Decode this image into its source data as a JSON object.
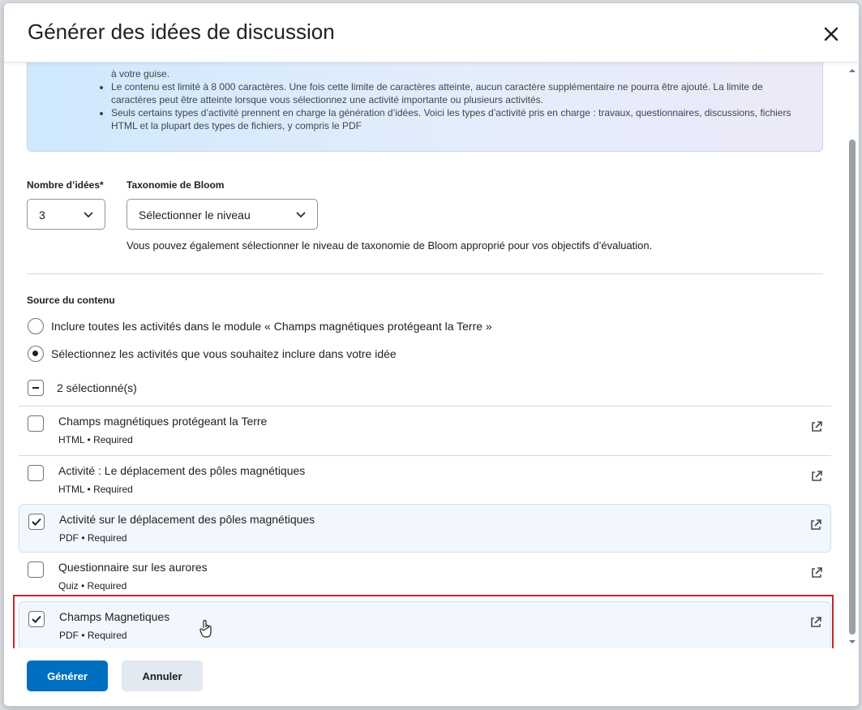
{
  "dialog": {
    "title": "Générer des idées de discussion"
  },
  "info": {
    "line0": "à votre guise.",
    "bullets": [
      "Le contenu est limité à 8 000 caractères. Une fois cette limite de caractères atteinte, aucun caractère supplémentaire ne pourra être ajouté. La limite de caractères peut être atteinte lorsque vous sélectionnez une activité importante ou plusieurs activités.",
      "Seuls certains types d’activité prennent en charge la génération d’idées. Voici les types d’activité pris en charge : travaux, questionnaires, discussions, fichiers HTML et la plupart des types de fichiers, y compris le PDF"
    ]
  },
  "form": {
    "ideas_label": "Nombre d’idées*",
    "ideas_value": "3",
    "bloom_label": "Taxonomie de Bloom",
    "bloom_value": "Sélectionner le niveau",
    "bloom_hint": "Vous pouvez également sélectionner le niveau de taxonomie de Bloom approprié pour vos objectifs d’évaluation."
  },
  "source": {
    "label": "Source du contenu",
    "options": [
      {
        "label": "Inclure toutes les activités dans le module « Champs magnétiques protégeant la Terre »",
        "selected": false
      },
      {
        "label": "Sélectionnez les activités que vous souhaitez inclure dans votre idée",
        "selected": true
      }
    ],
    "selected_count": "2 sélectionné(s)"
  },
  "activities": [
    {
      "name": "Champs magnétiques protégeant la Terre",
      "meta": "HTML • Required",
      "checked": false
    },
    {
      "name": "Activité : Le déplacement des pôles magnétiques",
      "meta": "HTML • Required",
      "checked": false
    },
    {
      "name": "Activité sur le déplacement des pôles magnétiques",
      "meta": "PDF • Required",
      "checked": true
    },
    {
      "name": "Questionnaire sur les aurores",
      "meta": "Quiz • Required",
      "checked": false
    },
    {
      "name": "Champs Magnetiques",
      "meta": "PDF • Required",
      "checked": true
    }
  ],
  "footer": {
    "generate": "Générer",
    "cancel": "Annuler"
  },
  "colors": {
    "primary": "#006fbf",
    "highlight": "#c1272d"
  }
}
